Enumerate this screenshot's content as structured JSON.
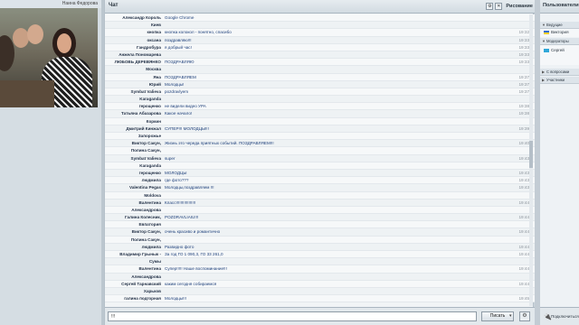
{
  "video": {
    "name_label": "Наина Федорова"
  },
  "chat": {
    "title": "Чат",
    "mode_label": "Рисование",
    "messages": [
      {
        "name": "Александр Король",
        "text": "Google Chrome",
        "time": ""
      },
      {
        "name": "Киев",
        "text": "",
        "time": ""
      },
      {
        "name": "кнопка",
        "text": "кнопка колокол - понятно, спасибо",
        "time": "19:32"
      },
      {
        "name": "оксана",
        "text": "поздравляю!!!",
        "time": "19:33"
      },
      {
        "name": "Гандробура",
        "text": "я добрый час!",
        "time": "19:33"
      },
      {
        "name": "Анжела Пономарева",
        "text": "",
        "time": "19:33"
      },
      {
        "name": "ЛЮБОВЬ ДЕРЕВЯНКО",
        "text": "ПОЗДРАВЛЯЮ",
        "time": "19:33"
      },
      {
        "name": "Москва",
        "text": "",
        "time": ""
      },
      {
        "name": "Яна",
        "text": "ПОЗДРАВЛЯЕМ",
        "time": "19:37"
      },
      {
        "name": "Юрий",
        "text": "Молодцы!",
        "time": "19:37"
      },
      {
        "name": "Symbat Valieva",
        "text": "pozdravlyem",
        "time": "19:37"
      },
      {
        "name": "Karaganda",
        "text": "",
        "time": ""
      },
      {
        "name": "герощенко",
        "text": "не видели видео УРА",
        "time": "19:38"
      },
      {
        "name": "Татьяна Абазарова",
        "text": "Какое начало!",
        "time": "19:38"
      },
      {
        "name": "Коркин",
        "text": "",
        "time": ""
      },
      {
        "name": "Дмитрий Кинжал",
        "text": "СУПЕР!!! МОЛОДЦЫ!!!",
        "time": "19:39"
      },
      {
        "name": "Запорожье",
        "text": "",
        "time": ""
      },
      {
        "name": "Виктор Сакун,",
        "text": "Жизнь это череда приятных событий. ПОЗДРАВЛЯЕМ!!!",
        "time": "19:40"
      },
      {
        "name": "Полина Сакун,",
        "text": "",
        "time": ""
      },
      {
        "name": "Symbat Valieva",
        "text": "super",
        "time": "19:43"
      },
      {
        "name": "Karaganda",
        "text": "",
        "time": ""
      },
      {
        "name": "герощенко",
        "text": "МОЛОДЦЫ",
        "time": "19:43"
      },
      {
        "name": "людмила",
        "text": "где фото???",
        "time": "19:43"
      },
      {
        "name": "Valentina Pegas",
        "text": "Молодцы,поздравляем !!!",
        "time": "19:43"
      },
      {
        "name": "Moldova",
        "text": "",
        "time": ""
      },
      {
        "name": "Валентина",
        "text": "Класс!!!!!!!!!!!!!!!!!",
        "time": "19:44"
      },
      {
        "name": "Александрова",
        "text": "",
        "time": ""
      },
      {
        "name": "Галина Колесник,",
        "text": "POZDRAVLIAIU!!!",
        "time": "19:44"
      },
      {
        "name": "Евпатория",
        "text": "",
        "time": ""
      },
      {
        "name": "Виктор Сакун,",
        "text": "очень красиво и романтично",
        "time": "19:44"
      },
      {
        "name": "Полина Сакун,",
        "text": "",
        "time": ""
      },
      {
        "name": "людмила",
        "text": "Развидно фото",
        "time": "19:44"
      },
      {
        "name": "Владимир Грынык -",
        "text": "За год ГО 1 090,3, ГО 33 261,0",
        "time": "19:44"
      },
      {
        "name": "Сумы",
        "text": "",
        "time": ""
      },
      {
        "name": "Валентина",
        "text": "Супер!!!!! Наше воспоминание!!!",
        "time": "19:44"
      },
      {
        "name": "Александрова",
        "text": "",
        "time": ""
      },
      {
        "name": "Сергей Тарнавский",
        "text": "каким сегодня собираемся",
        "time": "19:44"
      },
      {
        "name": "Харьков",
        "text": "",
        "time": ""
      },
      {
        "name": "галина подгорная",
        "text": "Молодцы!!!",
        "time": "19:45"
      }
    ],
    "input": {
      "value": "!!!",
      "send_label": "Писать"
    }
  },
  "users": {
    "title": "Пользователи",
    "groups": [
      {
        "label": "Ведущие",
        "top_row": 15
      },
      {
        "label": "Ведущие",
        "top_row": 41
      }
    ],
    "group_labels": [
      "Ведущие",
      "Модераторы",
      "С вопросами",
      "Участники"
    ],
    "entries": [
      "Виктория",
      "Сергей"
    ],
    "connect_label": "Подключиться"
  },
  "colors": {
    "accent": "#1d3f7a",
    "name_text": "#26344a",
    "time_text": "#8b939b",
    "panel_bg": "#f1f4f6",
    "frame_bg": "#c9d3da"
  },
  "icons": [
    "gear-icon",
    "close-icon",
    "connect-icon",
    "flag-ukraine-icon",
    "flag-kz-icon"
  ]
}
